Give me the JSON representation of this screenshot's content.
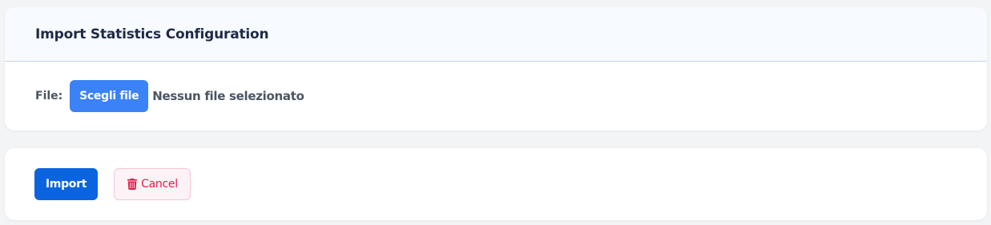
{
  "header": {
    "title": "Import Statistics Configuration"
  },
  "file_input": {
    "label": "File:",
    "button_label": "Scegli file",
    "status": "Nessun file selezionato"
  },
  "actions": {
    "import_label": "Import",
    "cancel_label": "Cancel",
    "cancel_icon": "trash-icon"
  },
  "colors": {
    "primary": "#0a64e0",
    "file_button": "#3b82f6",
    "danger": "#e11d48"
  }
}
